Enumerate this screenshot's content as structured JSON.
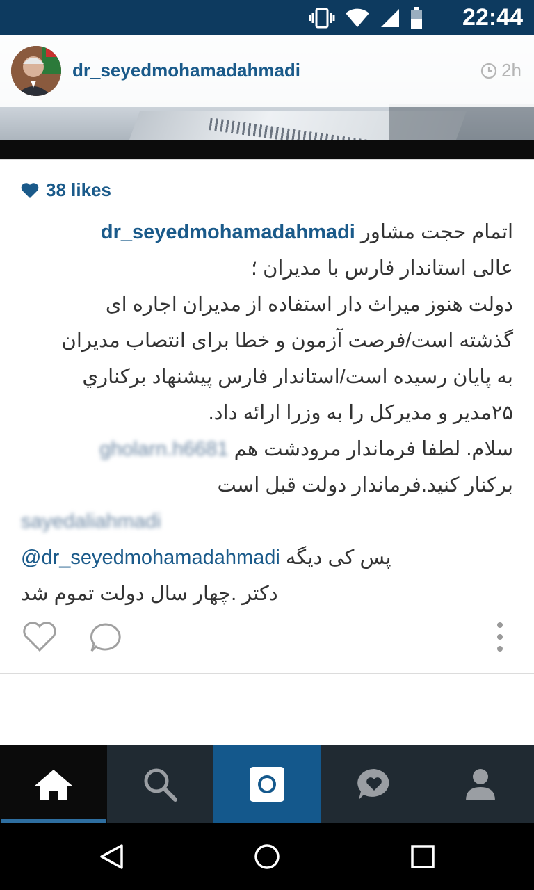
{
  "status_bar": {
    "time": "22:44",
    "icons": [
      "vibrate-icon",
      "wifi-icon",
      "signal-icon",
      "battery-icon"
    ],
    "background": "#0d3a5f"
  },
  "post": {
    "username": "dr_seyedmohamadahmadi",
    "time_ago": "2h",
    "likes": "38 likes",
    "accent_color": "#1a5a8a"
  },
  "caption": {
    "author": "dr_seyedmohamadahmadi",
    "lines": [
      "اتمام حجت مشاور",
      "عالی استاندار فارس با مدیران ؛",
      "دولت هنوز میراث دار استفاده از مدیران اجاره ای",
      "گذشته است/فرصت آزمون و خطا برای انتصاب مدیران",
      "به پایان رسیده است/استاندار فارس پیشنهاد برکناري",
      "۲۵مدیر و مدیرکل را به وزرا ارائه داد."
    ]
  },
  "comments": [
    {
      "username": "gholarn.h6681",
      "lines": [
        "سلام. لطفا فرماندار مرودشت هم",
        "برکنار کنید.فرماندار دولت قبل است"
      ]
    },
    {
      "username": "sayedaliahmadi",
      "mention": "@dr_seyedmohamadahmadi",
      "lines": [
        "پس کی دیگه",
        "دکتر .چهار سال دولت تموم شد"
      ]
    }
  ],
  "actions": {
    "icons": [
      "heart-icon",
      "comment-icon",
      "more-options-icon"
    ]
  },
  "tab_bar": {
    "items": [
      "home-icon",
      "search-icon",
      "camera-icon",
      "activity-icon",
      "profile-icon"
    ],
    "active": "home-icon"
  },
  "nav_bar": {
    "items": [
      "back-icon",
      "home-circle-icon",
      "recents-icon"
    ]
  }
}
